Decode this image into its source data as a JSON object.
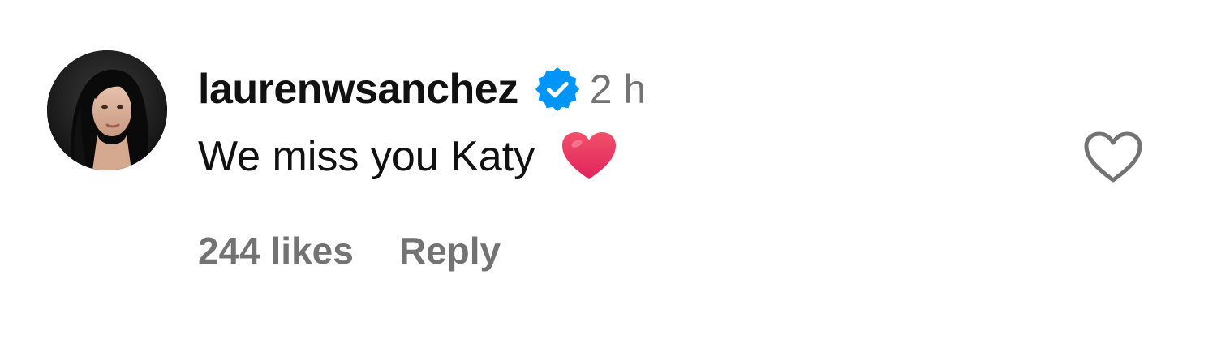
{
  "comment": {
    "username": "laurenwsanchez",
    "verified": true,
    "time_ago": "2 h",
    "text": "We miss you Katy",
    "emoji": "red-heart",
    "likes": "244 likes",
    "reply_label": "Reply"
  },
  "icons": {
    "verified": "verified-badge-icon",
    "like": "heart-outline-icon"
  },
  "colors": {
    "username": "#111111",
    "secondary_text": "#737373",
    "verified_badge": "#0095f6",
    "emoji_heart": "#ec3c5f",
    "like_icon": "#737373"
  }
}
